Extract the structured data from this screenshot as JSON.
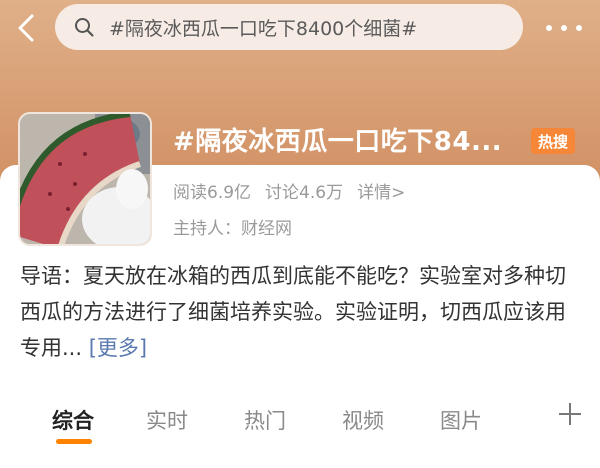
{
  "search": {
    "query": "#隔夜冰西瓜一口吃下8400个细菌#"
  },
  "topic": {
    "title": "#隔夜冰西瓜一口吃下84...",
    "badge": "热搜",
    "reads": "阅读6.9亿",
    "discussions": "讨论4.6万",
    "details": "详情>",
    "host": "主持人：财经网"
  },
  "intro": {
    "text": "导语：夏天放在冰箱的西瓜到底能不能吃？实验室对多种切西瓜的方法进行了细菌培养实验。实验证明，切西瓜应该用专用...",
    "more": "[更多]"
  },
  "tabs": [
    {
      "label": "综合",
      "active": true
    },
    {
      "label": "实时",
      "active": false
    },
    {
      "label": "热门",
      "active": false
    },
    {
      "label": "视频",
      "active": false
    },
    {
      "label": "图片",
      "active": false
    }
  ],
  "colors": {
    "hero": "#d9a078",
    "accent": "#ff8200",
    "badge": "#f68738",
    "link": "#5a7ab0"
  },
  "icons": [
    "back-arrow-icon",
    "search-icon",
    "more-dots-icon",
    "plus-icon"
  ]
}
